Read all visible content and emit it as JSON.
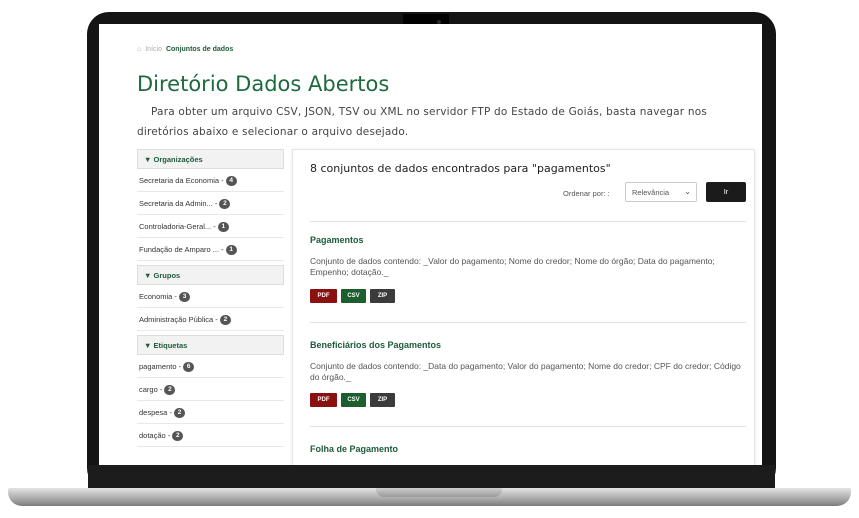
{
  "breadcrumb": {
    "home": "Início",
    "current": "Conjuntos de dados"
  },
  "page": {
    "title": "Diretório Dados Abertos",
    "intro": "Para obter um arquivo CSV, JSON, TSV ou XML no servidor FTP do Estado de Goiás, basta navegar nos diretórios abaixo e selecionar o arquivo desejado."
  },
  "sidebar": {
    "organizations": {
      "title": "Organizações",
      "items": [
        {
          "label": "Secretaria da Economia - ",
          "count": "4"
        },
        {
          "label": "Secretaria da Admin... - ",
          "count": "2"
        },
        {
          "label": "Controladoria-Geral... - ",
          "count": "1"
        },
        {
          "label": "Fundação de Amparo ... - ",
          "count": "1"
        }
      ]
    },
    "groups": {
      "title": "Grupos",
      "items": [
        {
          "label": "Economia - ",
          "count": "3"
        },
        {
          "label": "Administração Pública - ",
          "count": "2"
        }
      ]
    },
    "tags": {
      "title": "Etiquetas",
      "items": [
        {
          "label": "pagamento - ",
          "count": "6"
        },
        {
          "label": "cargo - ",
          "count": "2"
        },
        {
          "label": "despesa - ",
          "count": "2"
        },
        {
          "label": "dotação - ",
          "count": "2"
        }
      ]
    }
  },
  "results": {
    "count_text": "8 conjuntos de dados encontrados para \"pagamentos\"",
    "sort_label": "Ordenar por: :",
    "sort_value": "Relevância",
    "go_label": "Ir"
  },
  "datasets": [
    {
      "title": "Pagamentos",
      "description": "Conjunto de dados contendo: _Valor do pagamento; Nome do credor; Nome do órgão; Data do pagamento; Empenho; dotação._",
      "formats": [
        "PDF",
        "CSV",
        "ZIP"
      ]
    },
    {
      "title": "Beneficiários dos Pagamentos",
      "description": "Conjunto de dados contendo: _Data do pagamento; Valor do pagamento; Nome do credor; CPF do credor; Código do órgão._",
      "formats": [
        "PDF",
        "CSV",
        "ZIP"
      ]
    },
    {
      "title": "Folha de Pagamento"
    }
  ],
  "colors": {
    "brand_green": "#1e6a3f",
    "pdf": "#8b1111",
    "csv": "#1c5e2d",
    "zip": "#3b3b3b"
  }
}
